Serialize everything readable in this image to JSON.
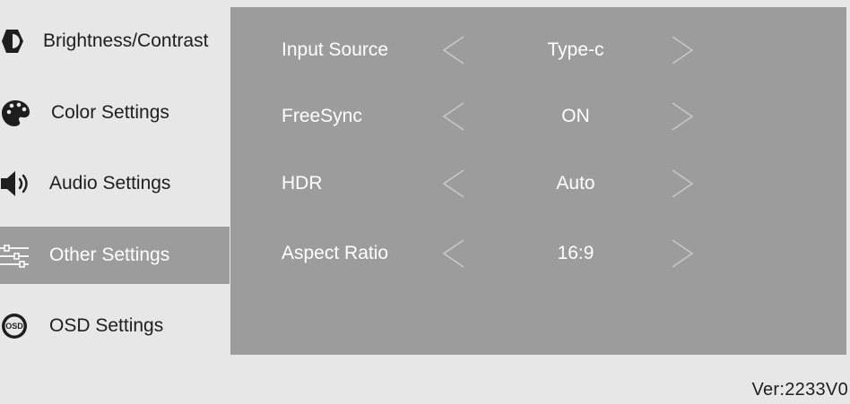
{
  "sidebar": {
    "items": [
      {
        "label": "Brightness/Contrast",
        "icon": "brightness-icon"
      },
      {
        "label": "Color Settings",
        "icon": "palette-icon"
      },
      {
        "label": "Audio Settings",
        "icon": "speaker-icon"
      },
      {
        "label": "Other Settings",
        "icon": "sliders-icon",
        "active": true
      },
      {
        "label": "OSD Settings",
        "icon": "osd-icon"
      }
    ]
  },
  "settings": [
    {
      "label": "Input Source",
      "value": "Type-c"
    },
    {
      "label": "FreeSync",
      "value": "ON"
    },
    {
      "label": "HDR",
      "value": "Auto"
    },
    {
      "label": "Aspect Ratio",
      "value": "16:9"
    }
  ],
  "footer": {
    "version": "Ver:2233V0"
  },
  "colors": {
    "background": "#e7e7e7",
    "panel": "#9c9c9c",
    "active": "#9c9c9c",
    "text_dark": "#1e1e1e",
    "text_light": "#ffffff"
  }
}
